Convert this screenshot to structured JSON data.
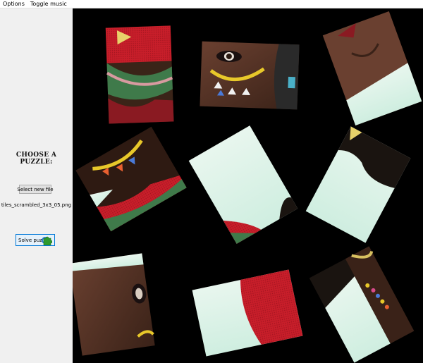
{
  "menubar": {
    "items": [
      "Options",
      "Toggle music"
    ]
  },
  "sidebar": {
    "choose_label": "Choose a puzzle:",
    "select_button": "Select new file",
    "filename": "tiles_scrambled_3x3_05.png",
    "solve_button": "Solve puz"
  },
  "board": {
    "tile_count": 9,
    "background": "#000000",
    "tiles": [
      {
        "name": "tile-1",
        "content": "red knit hat and green striped scarf"
      },
      {
        "name": "tile-2",
        "content": "eye with yellow face paint"
      },
      {
        "name": "tile-3",
        "content": "nose and lips against pale sky"
      },
      {
        "name": "tile-4",
        "content": "chin with face paint and scarf"
      },
      {
        "name": "tile-5",
        "content": "pale sky with dark hair corner"
      },
      {
        "name": "tile-6",
        "content": "dark hair over pale sky"
      },
      {
        "name": "tile-7",
        "content": "cheek and eye close-up"
      },
      {
        "name": "tile-8",
        "content": "red knit fabric over pale sky"
      },
      {
        "name": "tile-9",
        "content": "beaded necklace and hair"
      }
    ]
  }
}
